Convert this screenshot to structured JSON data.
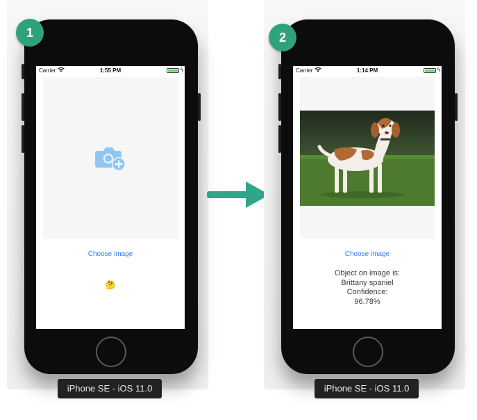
{
  "badges": {
    "left": "1",
    "right": "2"
  },
  "phones": {
    "left": {
      "carrier": "Carrier",
      "time": "1:55 PM",
      "choose_label": "Choose image",
      "emoji": "🤔",
      "placeholder_icon": "camera-add-icon",
      "device_label": "iPhone SE - iOS 11.0"
    },
    "right": {
      "carrier": "Carrier",
      "time": "1:14 PM",
      "choose_label": "Choose image",
      "result_lines": [
        "Object on image is:",
        "Brittany spaniel",
        "Confidence:",
        "96.78%"
      ],
      "device_label": "iPhone SE - iOS 11.0"
    }
  },
  "colors": {
    "accent": "#2f7bf5",
    "badge": "#2fa27c",
    "arrow": "#2fa58a",
    "camera_icon": "#8dc8f5"
  },
  "icons": [
    "wifi-icon",
    "battery-icon",
    "camera-add-icon",
    "arrow-right-icon"
  ]
}
